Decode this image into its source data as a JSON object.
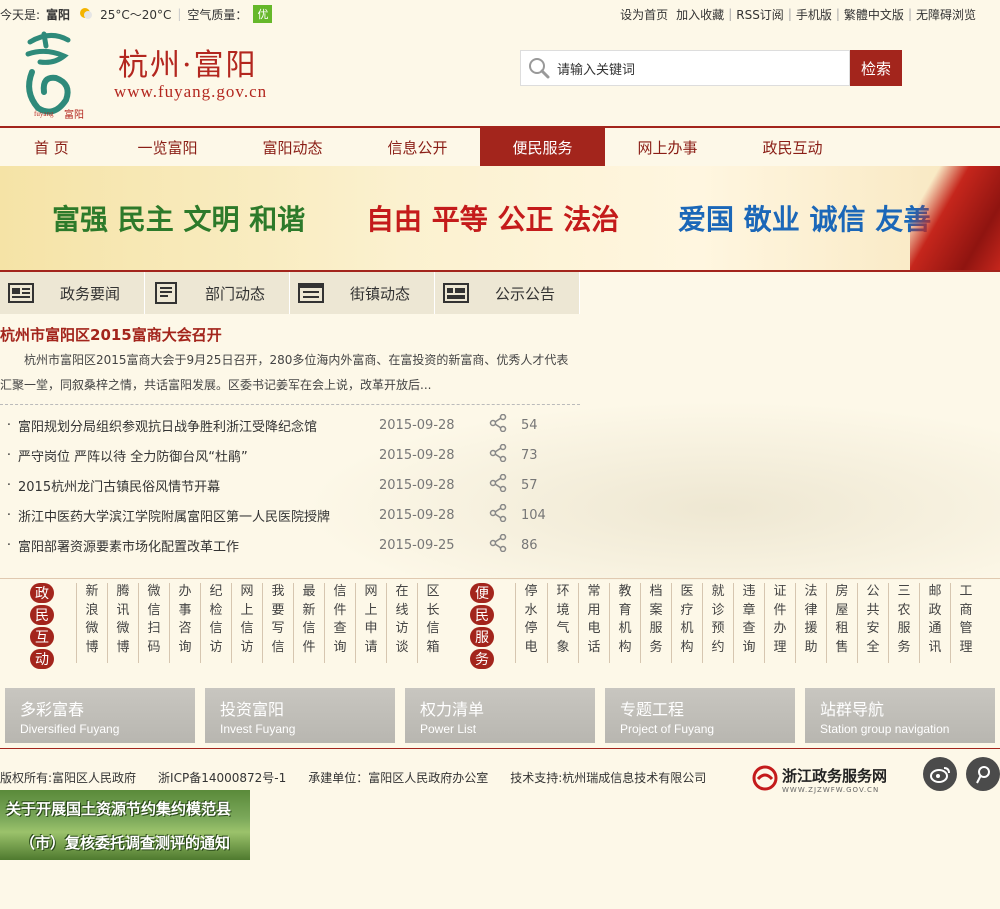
{
  "topbar": {
    "today_label": "今天是:",
    "city": "富阳",
    "temperature": "25°C～20°C",
    "aq_label": "空气质量：",
    "aq_value": "优",
    "links": [
      "设为首页",
      "加入收藏",
      "RSS订阅",
      "手机版",
      "繁體中文版",
      "无障碍浏览"
    ]
  },
  "header": {
    "logo_title": "杭州·富阳",
    "logo_url": "www.fuyang.gov.cn",
    "search_placeholder": "请输入关键词",
    "search_button": "检索"
  },
  "nav": {
    "items": [
      "首 页",
      "一览富阳",
      "富阳动态",
      "信息公开",
      "便民服务",
      "网上办事",
      "政民互动"
    ],
    "active": "便民服务"
  },
  "banner": {
    "slogan_1": "富强 民主 文明 和谐",
    "slogan_2": "自由 平等 公正 法治",
    "slogan_3": "爱国 敬业 诚信 友善"
  },
  "tabs": [
    "政务要闻",
    "部门动态",
    "街镇动态",
    "公示公告"
  ],
  "headline": {
    "title": "杭州市富阳区2015富商大会召开",
    "summary": "杭州市富阳区2015富商大会于9月25日召开，280多位海内外富商、在富投资的新富商、优秀人才代表汇聚一堂，同叙桑梓之情，共话富阳发展。区委书记姜军在会上说，改革开放后..."
  },
  "news": [
    {
      "title": "富阳规划分局组织参观抗日战争胜利浙江受降纪念馆",
      "date": "2015-09-28",
      "count": "54"
    },
    {
      "title": "严守岗位 严阵以待 全力防御台风“杜鹃”",
      "date": "2015-09-28",
      "count": "73"
    },
    {
      "title": "2015杭州龙门古镇民俗风情节开幕",
      "date": "2015-09-28",
      "count": "57"
    },
    {
      "title": "浙江中医药大学滨江学院附属富阳区第一人民医院授牌",
      "date": "2015-09-28",
      "count": "104"
    },
    {
      "title": "富阳部署资源要素市场化配置改革工作",
      "date": "2015-09-25",
      "count": "86"
    }
  ],
  "interaction": {
    "label": [
      "政",
      "民",
      "互",
      "动"
    ],
    "links": [
      "新浪微博",
      "腾讯微博",
      "微信扫码",
      "办事咨询",
      "纪检信访",
      "网上信访",
      "我要写信",
      "最新信件",
      "信件查询",
      "网上申请",
      "在线访谈",
      "区长信箱"
    ]
  },
  "services": {
    "label": [
      "便",
      "民",
      "服",
      "务"
    ],
    "links": [
      "停水停电",
      "环境气象",
      "常用电话",
      "教育机构",
      "档案服务",
      "医疗机构",
      "就诊预约",
      "违章查询",
      "证件办理",
      "法律援助",
      "房屋租售",
      "公共安全",
      "三农服务",
      "邮政通讯",
      "工商管理"
    ]
  },
  "tiles": [
    {
      "zh": "多彩富春",
      "en": "Diversified Fuyang"
    },
    {
      "zh": "投资富阳",
      "en": "Invest  Fuyang"
    },
    {
      "zh": "权力清单",
      "en": "Power List"
    },
    {
      "zh": "专题工程",
      "en": "Project of Fuyang"
    },
    {
      "zh": "站群导航",
      "en": "Station group navigation"
    }
  ],
  "footer": {
    "copyright": "版权所有:富阳区人民政府",
    "icp": "浙ICP备14000872号-1",
    "undertaker": "承建单位：富阳区人民政府办公室",
    "support": "技术支持:杭州瑞成信息技术有限公司",
    "zj_name": "浙江政务服务网",
    "zj_url": "WWW.ZJZWFW.GOV.CN"
  },
  "promo": {
    "line1": "关于开展国土资源节约集约模范县",
    "line2": "（市）复核委托调查测评的通知"
  },
  "colors": {
    "brand": "#a3251c",
    "aq": "#66b82a"
  }
}
